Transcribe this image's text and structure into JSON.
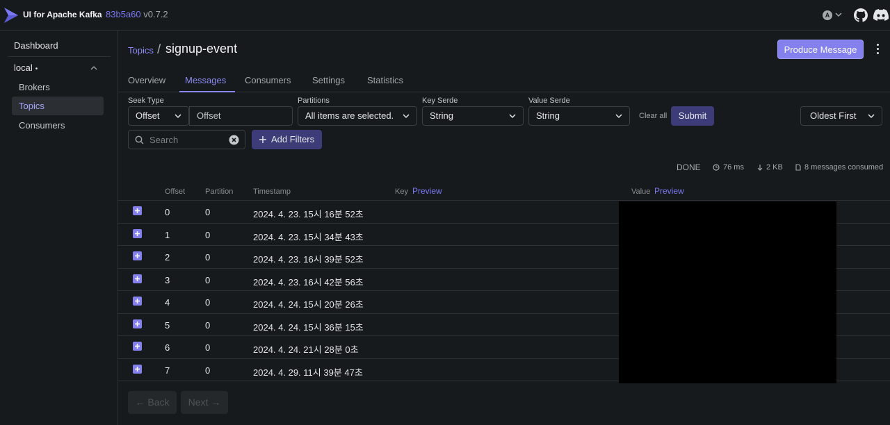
{
  "app": {
    "name": "UI for Apache Kafka",
    "commit": "83b5a60",
    "version": "v0.7.2",
    "avatar_letter": "A"
  },
  "sidebar": {
    "dashboard": "Dashboard",
    "cluster": {
      "name": "local",
      "status_dot": "•"
    },
    "items": [
      {
        "label": "Brokers",
        "active": false
      },
      {
        "label": "Topics",
        "active": true
      },
      {
        "label": "Consumers",
        "active": false
      }
    ]
  },
  "header": {
    "breadcrumb": "Topics",
    "separator": "/",
    "title": "signup-event",
    "produce_button": "Produce Message"
  },
  "tabs": [
    "Overview",
    "Messages",
    "Consumers",
    "Settings",
    "Statistics"
  ],
  "filters": {
    "seek_type_label": "Seek Type",
    "seek_type_value": "Offset",
    "offset_placeholder": "Offset",
    "partitions_label": "Partitions",
    "partitions_value": "All items are selected.",
    "key_serde_label": "Key Serde",
    "key_serde_value": "String",
    "value_serde_label": "Value Serde",
    "value_serde_value": "String",
    "clear_all": "Clear all",
    "submit": "Submit",
    "sort_value": "Oldest First",
    "search_placeholder": "Search",
    "add_filters": "Add Filters"
  },
  "stats": {
    "status": "DONE",
    "elapsed": "76 ms",
    "size": "2 KB",
    "consumed": "8 messages consumed"
  },
  "table": {
    "headers": {
      "offset": "Offset",
      "partition": "Partition",
      "timestamp": "Timestamp",
      "key": "Key",
      "value": "Value",
      "preview": "Preview"
    },
    "rows": [
      {
        "offset": "0",
        "partition": "0",
        "timestamp": "2024. 4. 23. 15시 16분 52초"
      },
      {
        "offset": "1",
        "partition": "0",
        "timestamp": "2024. 4. 23. 15시 34분 43초"
      },
      {
        "offset": "2",
        "partition": "0",
        "timestamp": "2024. 4. 23. 16시 39분 52초"
      },
      {
        "offset": "3",
        "partition": "0",
        "timestamp": "2024. 4. 23. 16시 42분 56초"
      },
      {
        "offset": "4",
        "partition": "0",
        "timestamp": "2024. 4. 24. 15시 20분 26초"
      },
      {
        "offset": "5",
        "partition": "0",
        "timestamp": "2024. 4. 24. 15시 36분 15초"
      },
      {
        "offset": "6",
        "partition": "0",
        "timestamp": "2024. 4. 24. 21시 28분 0초"
      },
      {
        "offset": "7",
        "partition": "0",
        "timestamp": "2024. 4. 29. 11시 39분 47초"
      }
    ]
  },
  "pagination": {
    "back": "← Back",
    "next": "Next →"
  }
}
